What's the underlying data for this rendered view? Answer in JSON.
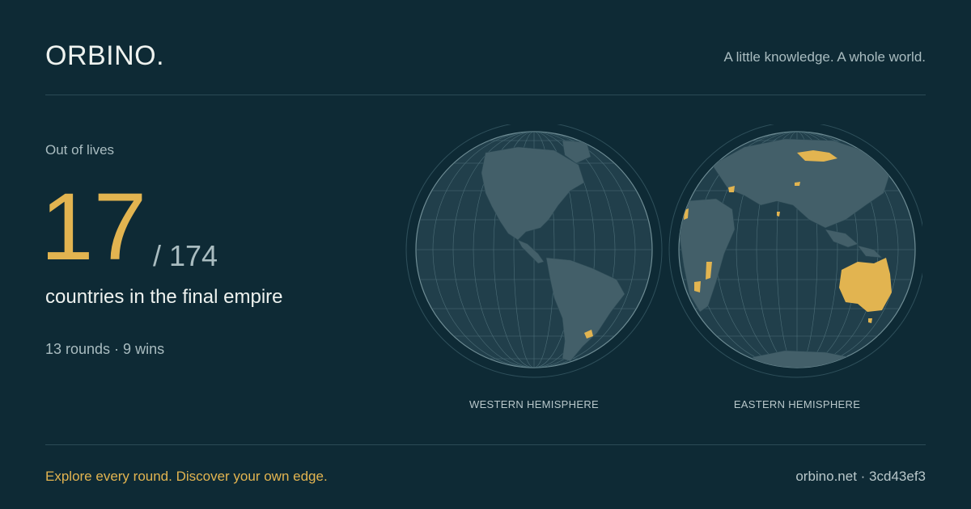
{
  "header": {
    "brand": "ORBINO.",
    "tagline": "A little knowledge. A whole world."
  },
  "result": {
    "status": "Out of lives",
    "count": "17",
    "total": "/ 174",
    "caption": "countries in the final empire",
    "meta": "13 rounds · 9 wins"
  },
  "globes": {
    "western_label": "WESTERN HEMISPHERE",
    "eastern_label": "EASTERN HEMISPHERE"
  },
  "footer": {
    "cta": "Explore every round. Discover your own edge.",
    "site": "orbino.net · 3cd43ef3"
  },
  "colors": {
    "background": "#0e2a35",
    "ocean": "#213f4b",
    "land": "#435f69",
    "owned": "#e2b450",
    "grid": "#5e7d86"
  }
}
